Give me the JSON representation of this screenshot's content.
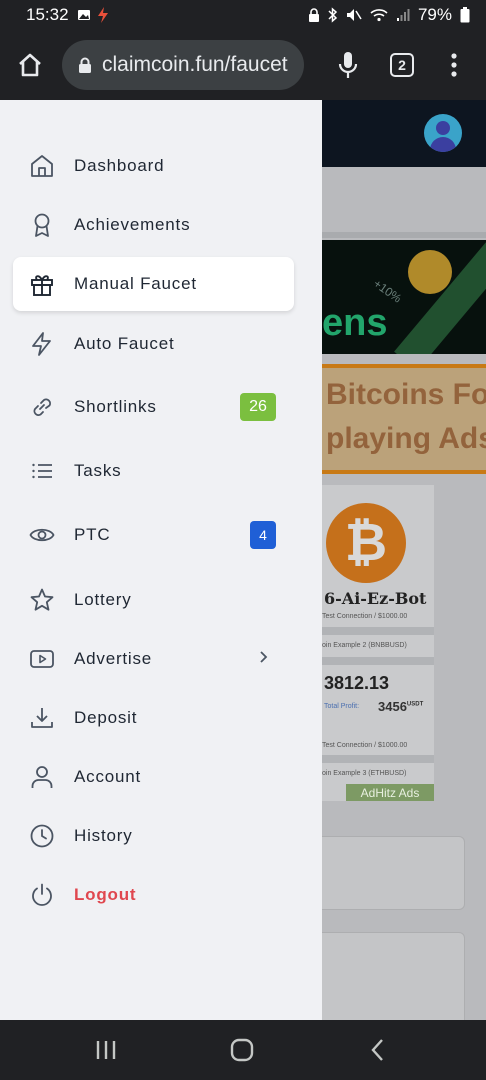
{
  "status_bar": {
    "time": "15:32",
    "battery": "79%"
  },
  "browser": {
    "url": "claimcoin.fun/faucet",
    "tab_count": "2"
  },
  "drawer": {
    "items": [
      {
        "label": "Dashboard",
        "icon": "home-icon"
      },
      {
        "label": "Achievements",
        "icon": "award-icon"
      },
      {
        "label": "Manual Faucet",
        "icon": "gift-icon",
        "active": true
      },
      {
        "label": "Auto Faucet",
        "icon": "bolt-icon"
      },
      {
        "label": "Shortlinks",
        "icon": "link-icon",
        "badge": "26"
      },
      {
        "label": "Tasks",
        "icon": "list-icon"
      },
      {
        "label": "PTC",
        "icon": "eye-icon",
        "badge": "4"
      },
      {
        "label": "Lottery",
        "icon": "star-icon"
      },
      {
        "label": "Advertise",
        "icon": "video-icon"
      },
      {
        "label": "Deposit",
        "icon": "download-icon"
      },
      {
        "label": "Account",
        "icon": "user-icon"
      },
      {
        "label": "History",
        "icon": "clock-icon"
      },
      {
        "label": "Logout",
        "icon": "power-icon"
      }
    ]
  },
  "site": {
    "banner_text": "ens",
    "banner_pct": "+10%",
    "promo_line1": "Bitcoins Fo",
    "promo_line2": "playing Ads",
    "bot_name": "6-Ai-Ez-Bot",
    "test_conn_1": "Test Connection / $1000.00",
    "coin_example_2": "oin Example 2 (BNBBUSD)",
    "price": "3812.13",
    "total_profit_label": "Total Profit:",
    "total_profit_value": "3456",
    "total_profit_unit": "USDT",
    "test_conn_2": "Test Connection / $1000.00",
    "coin_example_3": "oin Example 3 (ETHBUSD)",
    "ad_network": "AdHitz Ads"
  },
  "colors": {
    "accent_green": "#7bbf3f",
    "accent_blue": "#1f5fd6",
    "logout_red": "#e0474f"
  }
}
